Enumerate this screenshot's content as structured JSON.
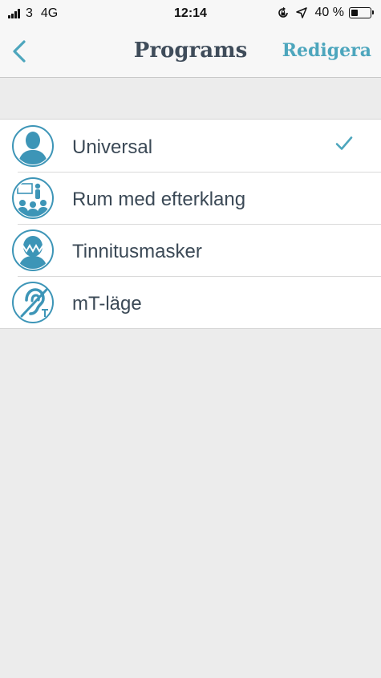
{
  "status_bar": {
    "carrier": "3",
    "network": "4G",
    "time": "12:14",
    "battery_text": "40 %",
    "battery_level": 0.4,
    "icons": [
      "signal-bars-icon",
      "rotation-lock-icon",
      "location-arrow-icon",
      "battery-icon"
    ]
  },
  "navbar": {
    "back_icon": "chevron-left-icon",
    "title": "Programs",
    "edit_label": "Redigera"
  },
  "programs": [
    {
      "label": "Universal",
      "icon": "person-head-icon",
      "selected": true
    },
    {
      "label": "Rum med efterklang",
      "icon": "meeting-room-icon",
      "selected": false
    },
    {
      "label": "Tinnitusmasker",
      "icon": "tinnitus-head-icon",
      "selected": false
    },
    {
      "label": "mT-läge",
      "icon": "hearing-loop-icon",
      "selected": false
    }
  ],
  "colors": {
    "accent": "#4da6bd",
    "title": "#3f4c5a",
    "text": "#3b4956",
    "background": "#ececec",
    "icon_fill": "#3d95b7"
  }
}
